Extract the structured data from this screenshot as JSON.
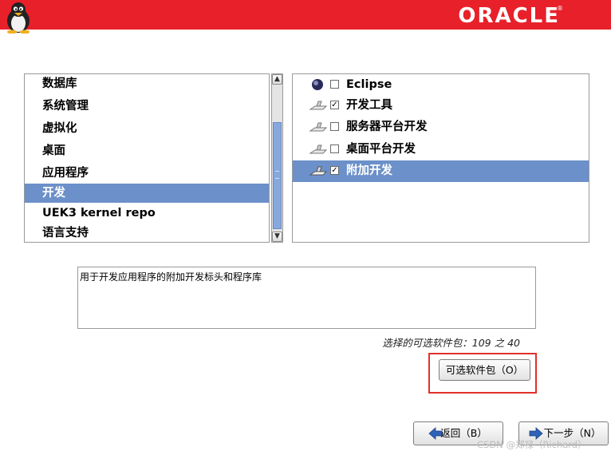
{
  "header": {
    "logo_text": "ORACLE",
    "logo_mark": "®"
  },
  "categories": {
    "items": [
      {
        "label": "数据库"
      },
      {
        "label": "系统管理"
      },
      {
        "label": "虚拟化"
      },
      {
        "label": "桌面"
      },
      {
        "label": "应用程序"
      },
      {
        "label": "开发"
      },
      {
        "label": "UEK3 kernel repo"
      },
      {
        "label": "语言支持"
      }
    ],
    "selected_index": 5
  },
  "groups": {
    "items": [
      {
        "label": "Eclipse",
        "checked": false,
        "icon": "eclipse-icon"
      },
      {
        "label": "开发工具",
        "checked": true,
        "icon": "dev-tools-icon"
      },
      {
        "label": "服务器平台开发",
        "checked": false,
        "icon": "dev-tools-icon"
      },
      {
        "label": "桌面平台开发",
        "checked": false,
        "icon": "dev-tools-icon"
      },
      {
        "label": "附加开发",
        "checked": true,
        "icon": "dev-tools-icon"
      }
    ],
    "selected_index": 4
  },
  "description": "用于开发应用程序的附加开发标头和程序库",
  "package_count": "选择的可选软件包：109 之 40",
  "buttons": {
    "optional_packages": "可选软件包（O）",
    "back": "返回（B）",
    "next": "下一步（N）"
  },
  "watermark": "CSDN @郑禄（Richard）",
  "colors": {
    "banner": "#e8202a",
    "selection": "#6c90c9",
    "highlight": "#e0302a"
  }
}
